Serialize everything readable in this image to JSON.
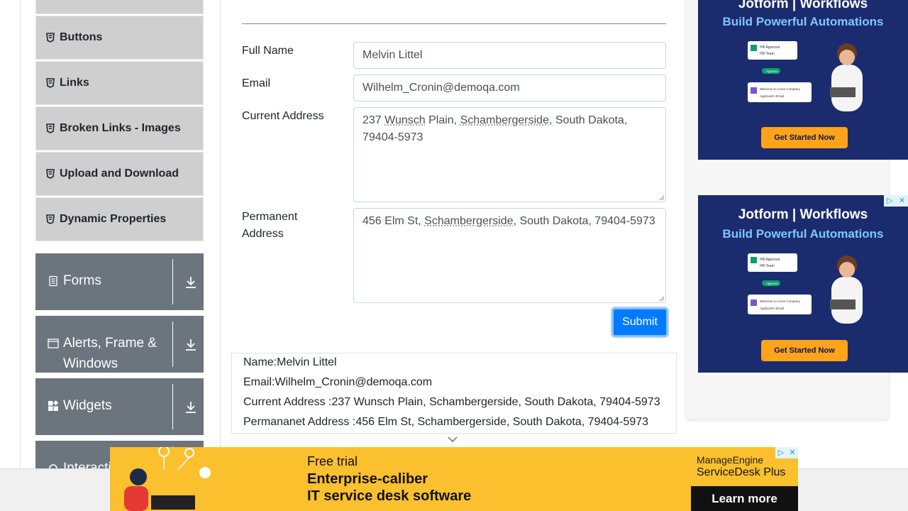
{
  "sidebar": {
    "elements_items": [
      {
        "label": "Buttons"
      },
      {
        "label": "Links"
      },
      {
        "label": "Broken Links - Images"
      },
      {
        "label": "Upload and Download"
      },
      {
        "label": "Dynamic Properties"
      }
    ],
    "groups": [
      {
        "label": "Forms",
        "icon": "form-icon"
      },
      {
        "label": "Alerts, Frame & Windows",
        "icon": "window-icon"
      },
      {
        "label": "Widgets",
        "icon": "widgets-icon"
      },
      {
        "label": "Interactions",
        "icon": "interactions-icon"
      }
    ]
  },
  "form": {
    "full_name_label": "Full Name",
    "full_name_value": "Melvin Littel",
    "email_label": "Email",
    "email_value": "Wilhelm_Cronin@demoqa.com",
    "current_address_label": "Current Address",
    "current_address_parts": [
      "237 ",
      "Wunsch",
      " Plain, ",
      "Schambergerside",
      ", South Dakota,",
      "79404-5973"
    ],
    "permanent_address_label_1": "Permanent",
    "permanent_address_label_2": "Address",
    "permanent_address_parts": [
      "456 Elm St, ",
      "Schambergerside",
      ", South Dakota, 79404-5973"
    ],
    "submit_label": "Submit"
  },
  "output": {
    "name": "Name:Melvin Littel",
    "email": "Email:Wilhelm_Cronin@demoqa.com",
    "current_address": "Current Address :237 Wunsch Plain, Schambergerside, South Dakota, 79404-5973",
    "permanent_address": "Permananet Address :456 Elm St, Schambergerside, South Dakota, 79404-5973"
  },
  "ads": {
    "right": {
      "brand": "Jotform | Workflows",
      "headline": "Build Powerful Automations",
      "cta": "Get Started Now",
      "card_text_1": "HR Approval",
      "card_text_2": "HR Team",
      "card_text_3": "Approve",
      "card_text_4": "Welcome to Acme Company",
      "card_text_5": "Applicant's Email"
    },
    "banner": {
      "line1": "Free trial",
      "line2": "Enterprise-caliber",
      "line3": "IT service desk software",
      "brand1": "ManageEngine",
      "brand2": "ServiceDesk Plus",
      "cta": "Learn more"
    },
    "close_glyph": "✕",
    "info_glyph": "▷",
    "accent": "#ffa31a"
  },
  "colors": {
    "submit": "#007bff",
    "sidebar_group": "#6c757d",
    "sidebar_item": "#cfcfcf"
  }
}
